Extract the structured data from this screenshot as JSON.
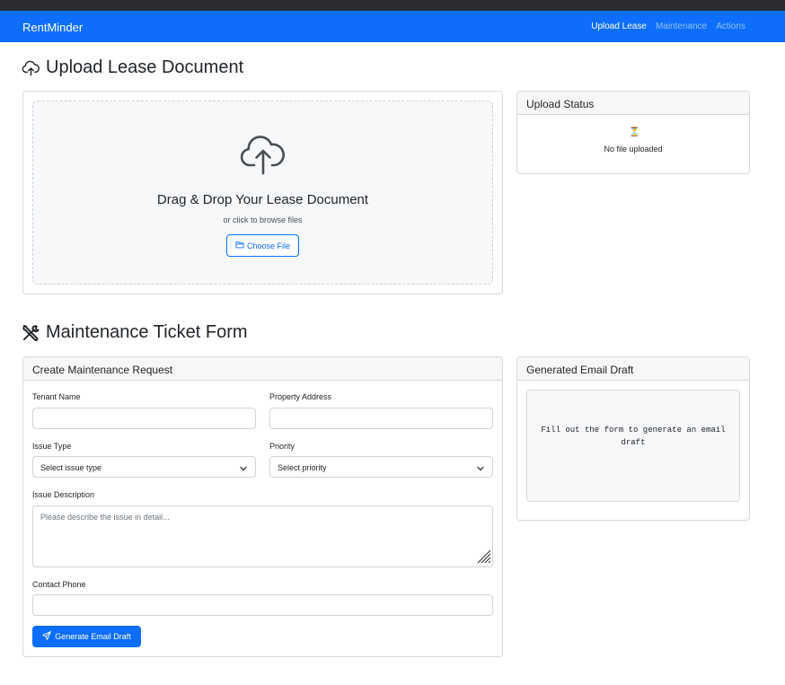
{
  "navbar": {
    "brand": "RentMinder",
    "links": [
      {
        "label": "Upload Lease",
        "active": true
      },
      {
        "label": "Maintenance",
        "active": false
      },
      {
        "label": "Actions",
        "active": false
      }
    ]
  },
  "upload": {
    "title": "Upload Lease Document",
    "title_icon": "cloud-upload-icon",
    "dropzone_title": "Drag & Drop Your Lease Document",
    "dropzone_subtitle": "or click to browse files",
    "choose_file_label": "Choose File",
    "choose_file_icon": "folder-icon"
  },
  "upload_status": {
    "header": "Upload Status",
    "icon": "hourglass-icon",
    "text": "No file uploaded"
  },
  "maintenance": {
    "title": "Maintenance Ticket Form",
    "title_icon": "tools-icon",
    "form_header": "Create Maintenance Request",
    "fields": {
      "tenant_name": {
        "label": "Tenant Name",
        "value": ""
      },
      "property_address": {
        "label": "Property Address",
        "value": ""
      },
      "issue_type": {
        "label": "Issue Type",
        "selected": "Select issue type"
      },
      "priority": {
        "label": "Priority",
        "selected": "Select priority"
      },
      "issue_description": {
        "label": "Issue Description",
        "placeholder": "Please describe the issue in detail..."
      },
      "contact_phone": {
        "label": "Contact Phone",
        "value": ""
      }
    },
    "submit_label": "Generate Email Draft",
    "submit_icon": "send-icon"
  },
  "email_draft": {
    "header": "Generated Email Draft",
    "placeholder": "Fill out the form to generate an email draft"
  },
  "colors": {
    "primary": "#0d6efd",
    "navbar_bg": "#0d6efd",
    "status_icon": "#e0a800"
  }
}
